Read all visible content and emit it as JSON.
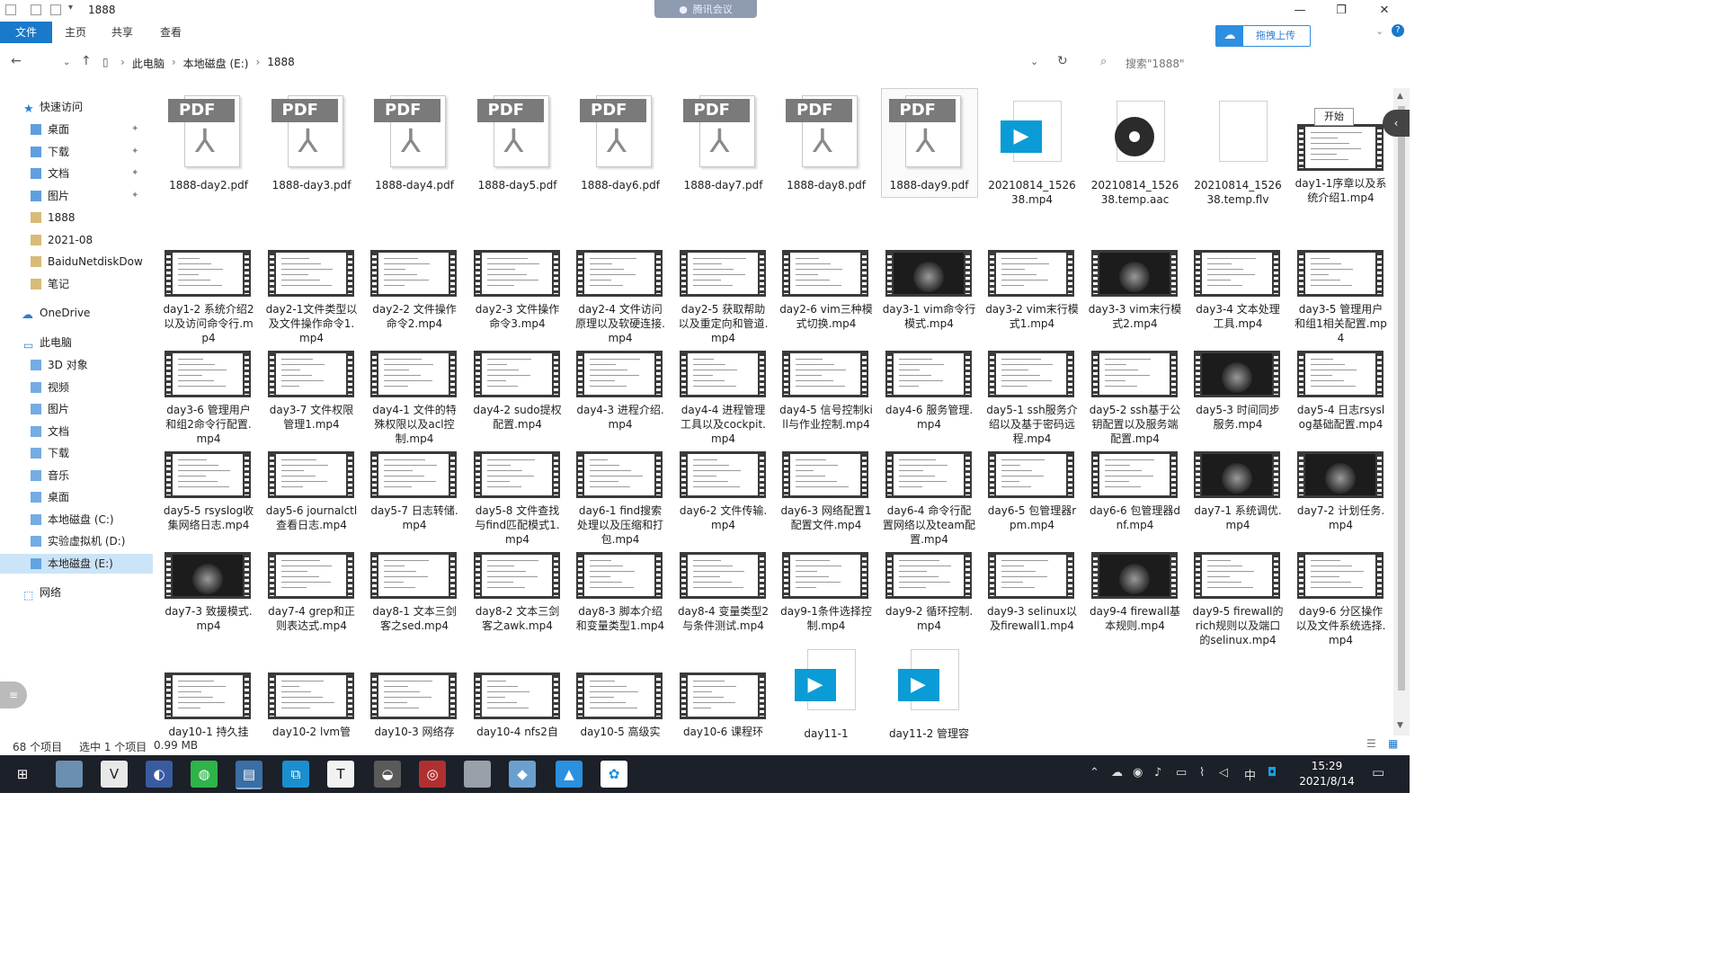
{
  "window": {
    "title": "1888",
    "meeting_label": "腾讯会议",
    "minimize": "—",
    "maximize": "❐",
    "close": "✕"
  },
  "ribbon": {
    "tabs": [
      "文件",
      "主页",
      "共享",
      "查看"
    ],
    "upload_label": "拖拽上传"
  },
  "address": {
    "crumbs": [
      "此电脑",
      "本地磁盘 (E:)",
      "1888"
    ],
    "search_placeholder": "搜索\"1888\""
  },
  "nav": {
    "quick_access": "快速访问",
    "items": [
      {
        "label": "桌面",
        "icon": "desktop-icon",
        "pinned": true
      },
      {
        "label": "下载",
        "icon": "download-icon",
        "pinned": true
      },
      {
        "label": "文档",
        "icon": "document-icon",
        "pinned": true
      },
      {
        "label": "图片",
        "icon": "picture-icon",
        "pinned": true
      },
      {
        "label": "1888",
        "icon": "folder-icon",
        "pinned": false
      },
      {
        "label": "2021-08",
        "icon": "folder-icon",
        "pinned": false
      },
      {
        "label": "BaiduNetdiskDow",
        "icon": "folder-icon",
        "pinned": false
      },
      {
        "label": "笔记",
        "icon": "folder-icon",
        "pinned": false
      }
    ],
    "onedrive": "OneDrive",
    "this_pc": "此电脑",
    "pc_items": [
      {
        "label": "3D 对象",
        "icon": "3d-objects-icon"
      },
      {
        "label": "视频",
        "icon": "video-folder-icon"
      },
      {
        "label": "图片",
        "icon": "picture-icon"
      },
      {
        "label": "文档",
        "icon": "document-icon"
      },
      {
        "label": "下载",
        "icon": "download-icon"
      },
      {
        "label": "音乐",
        "icon": "music-icon"
      },
      {
        "label": "桌面",
        "icon": "desktop-icon"
      },
      {
        "label": "本地磁盘 (C:)",
        "icon": "drive-icon"
      },
      {
        "label": "实验虚拟机 (D:)",
        "icon": "drive-icon"
      },
      {
        "label": "本地磁盘 (E:)",
        "icon": "drive-icon"
      }
    ],
    "network": "网络"
  },
  "tooltip": "开始",
  "files": [
    {
      "name": "1888-day2.pdf",
      "type": "pdf"
    },
    {
      "name": "1888-day3.pdf",
      "type": "pdf"
    },
    {
      "name": "1888-day4.pdf",
      "type": "pdf"
    },
    {
      "name": "1888-day5.pdf",
      "type": "pdf"
    },
    {
      "name": "1888-day6.pdf",
      "type": "pdf"
    },
    {
      "name": "1888-day7.pdf",
      "type": "pdf"
    },
    {
      "name": "1888-day8.pdf",
      "type": "pdf"
    },
    {
      "name": "1888-day9.pdf",
      "type": "pdf",
      "selected": true
    },
    {
      "name": "20210814_152638.mp4",
      "type": "mp4"
    },
    {
      "name": "20210814_152638.temp.aac",
      "type": "aac"
    },
    {
      "name": "20210814_152638.temp.flv",
      "type": "blank"
    },
    {
      "name": "day1-1序章以及系统介绍1.mp4",
      "type": "video"
    },
    {
      "name": "day1-2 系统介绍2以及访问命令行.mp4",
      "type": "video"
    },
    {
      "name": "day2-1文件类型以及文件操作命令1.mp4",
      "type": "video"
    },
    {
      "name": "day2-2 文件操作命令2.mp4",
      "type": "video"
    },
    {
      "name": "day2-3 文件操作命令3.mp4",
      "type": "video"
    },
    {
      "name": "day2-4 文件访问原理以及软硬连接.mp4",
      "type": "video"
    },
    {
      "name": "day2-5 获取帮助以及重定向和管道.mp4",
      "type": "video"
    },
    {
      "name": "day2-6 vim三种模式切换.mp4",
      "type": "video"
    },
    {
      "name": "day3-1 vim命令行模式.mp4",
      "type": "video-dark"
    },
    {
      "name": "day3-2 vim末行模式1.mp4",
      "type": "video"
    },
    {
      "name": "day3-3 vim末行模式2.mp4",
      "type": "video-dark"
    },
    {
      "name": "day3-4 文本处理工具.mp4",
      "type": "video"
    },
    {
      "name": "day3-5 管理用户和组1相关配置.mp4",
      "type": "video"
    },
    {
      "name": "day3-6 管理用户和组2命令行配置.mp4",
      "type": "video"
    },
    {
      "name": "day3-7 文件权限管理1.mp4",
      "type": "video"
    },
    {
      "name": "day4-1 文件的特殊权限以及acl控制.mp4",
      "type": "video"
    },
    {
      "name": "day4-2 sudo提权配置.mp4",
      "type": "video"
    },
    {
      "name": "day4-3 进程介绍.mp4",
      "type": "video"
    },
    {
      "name": "day4-4 进程管理工具以及cockpit.mp4",
      "type": "video"
    },
    {
      "name": "day4-5 信号控制kill与作业控制.mp4",
      "type": "video"
    },
    {
      "name": "day4-6 服务管理.mp4",
      "type": "video"
    },
    {
      "name": "day5-1 ssh服务介绍以及基于密码远程.mp4",
      "type": "video"
    },
    {
      "name": "day5-2 ssh基于公钥配置以及服务端配置.mp4",
      "type": "video"
    },
    {
      "name": "day5-3 时间同步服务.mp4",
      "type": "video-dark"
    },
    {
      "name": "day5-4 日志rsyslog基础配置.mp4",
      "type": "video"
    },
    {
      "name": "day5-5 rsyslog收集网络日志.mp4",
      "type": "video"
    },
    {
      "name": "day5-6 journalctl查看日志.mp4",
      "type": "video"
    },
    {
      "name": "day5-7 日志转储.mp4",
      "type": "video"
    },
    {
      "name": "day5-8 文件查找与find匹配模式1.mp4",
      "type": "video"
    },
    {
      "name": "day6-1 find搜索处理以及压缩和打包.mp4",
      "type": "video"
    },
    {
      "name": "day6-2 文件传输.mp4",
      "type": "video"
    },
    {
      "name": "day6-3 网络配置1配置文件.mp4",
      "type": "video"
    },
    {
      "name": "day6-4 命令行配置网络以及team配置.mp4",
      "type": "video"
    },
    {
      "name": "day6-5 包管理器rpm.mp4",
      "type": "video"
    },
    {
      "name": "day6-6 包管理器dnf.mp4",
      "type": "video"
    },
    {
      "name": "day7-1 系统调优.mp4",
      "type": "video-dark"
    },
    {
      "name": "day7-2 计划任务.mp4",
      "type": "video-dark"
    },
    {
      "name": "day7-3 致援模式.mp4",
      "type": "video-dark"
    },
    {
      "name": "day7-4 grep和正则表达式.mp4",
      "type": "video"
    },
    {
      "name": "day8-1 文本三剑客之sed.mp4",
      "type": "video"
    },
    {
      "name": "day8-2 文本三剑客之awk.mp4",
      "type": "video"
    },
    {
      "name": "day8-3 脚本介绍和变量类型1.mp4",
      "type": "video"
    },
    {
      "name": "day8-4 变量类型2与条件测试.mp4",
      "type": "video"
    },
    {
      "name": "day9-1条件选择控制.mp4",
      "type": "video"
    },
    {
      "name": "day9-2 循环控制.mp4",
      "type": "video"
    },
    {
      "name": "day9-3 selinux以及firewall1.mp4",
      "type": "video"
    },
    {
      "name": "day9-4 firewall基本规则.mp4",
      "type": "video-dark"
    },
    {
      "name": "day9-5 firewall的rich规则以及端口的selinux.mp4",
      "type": "video"
    },
    {
      "name": "day9-6 分区操作以及文件系统选择.mp4",
      "type": "video"
    },
    {
      "name": "day10-1 持久挂",
      "type": "video"
    },
    {
      "name": "day10-2 lvm管",
      "type": "video"
    },
    {
      "name": "day10-3 网络存",
      "type": "video"
    },
    {
      "name": "day10-4 nfs2自",
      "type": "video"
    },
    {
      "name": "day10-5 高级实",
      "type": "video"
    },
    {
      "name": "day10-6 课程环",
      "type": "video"
    },
    {
      "name": "day11-1",
      "type": "mp4"
    },
    {
      "name": "day11-2 管理容",
      "type": "mp4"
    }
  ],
  "status": {
    "item_count": "68 个项目",
    "selection": "选中 1 个项目",
    "size": "0.99 MB"
  },
  "taskbar": {
    "apps": [
      "windows-icon",
      "photo-app-icon",
      "vivaldi-icon",
      "browser-icon",
      "wechat-icon",
      "explorer-icon",
      "window-switch-icon",
      "typora-icon",
      "bird-app-icon",
      "music-app-icon",
      "image-viewer-icon",
      "notes-app-icon",
      "photos-icon",
      "baidu-netdisk-icon"
    ],
    "typora_glyph": "T",
    "ime": "中",
    "time": "15:29",
    "date": "2021/8/14"
  },
  "colors": {
    "accent": "#1979ca",
    "taskbar": "#1c2028",
    "selection": "#cce4f7"
  }
}
